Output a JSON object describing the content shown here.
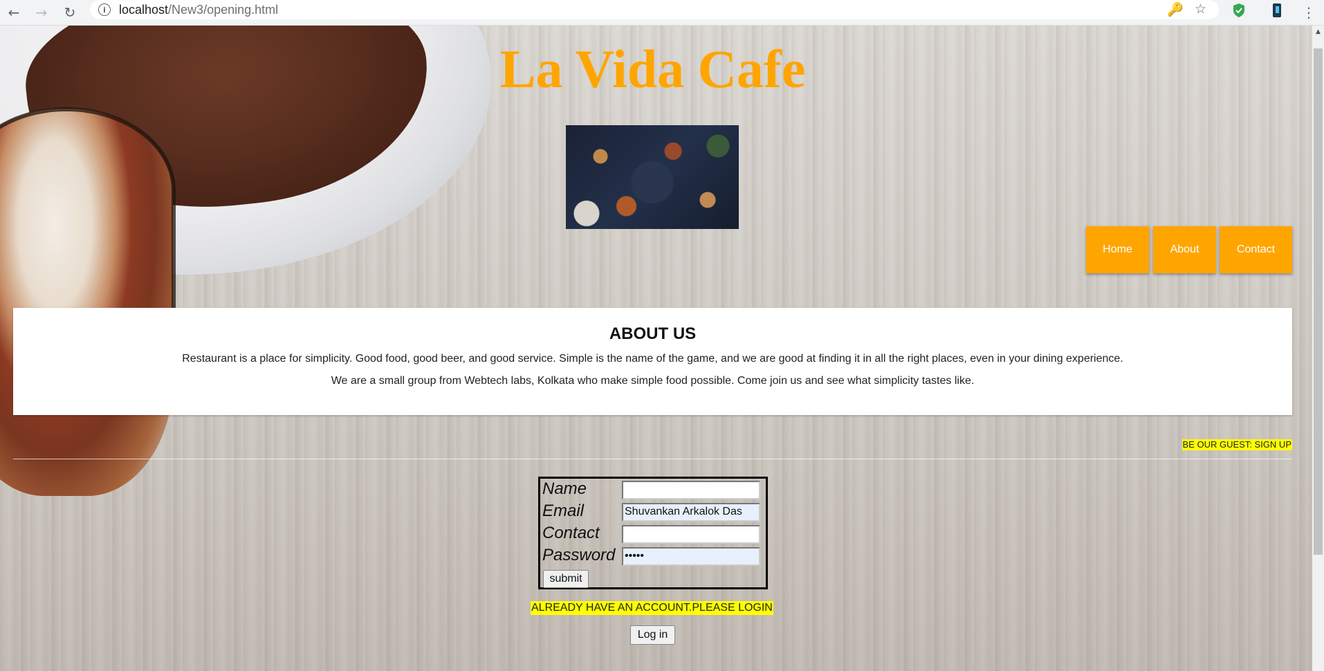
{
  "browser": {
    "url_host": "localhost",
    "url_path": "/New3/opening.html"
  },
  "site": {
    "title": "La Vida Cafe",
    "nav": [
      {
        "label": "Home"
      },
      {
        "label": "About"
      },
      {
        "label": "Contact"
      }
    ]
  },
  "about": {
    "heading": "ABOUT US",
    "line1": "Restaurant is a place for simplicity. Good food, good beer, and good service. Simple is the name of the game, and we are good at finding it in all the right places, even in your dining experience.",
    "line2": "We are a small group from Webtech labs, Kolkata who make simple food possible. Come join us and see what simplicity tastes like."
  },
  "signup": {
    "link_label": "BE OUR GUEST: SIGN UP",
    "form": {
      "name_label": "Name",
      "name_value": "",
      "email_label": "Email",
      "email_value": "Shuvankan Arkalok Das",
      "contact_label": "Contact",
      "contact_value": "",
      "password_label": "Password",
      "password_value": "•••••",
      "submit_label": "submit"
    }
  },
  "login": {
    "note": "ALREADY HAVE AN ACCOUNT.PLEASE LOGIN",
    "button_label": "Log in"
  },
  "colors": {
    "accent": "#ffa500",
    "highlight": "#ffff00"
  }
}
